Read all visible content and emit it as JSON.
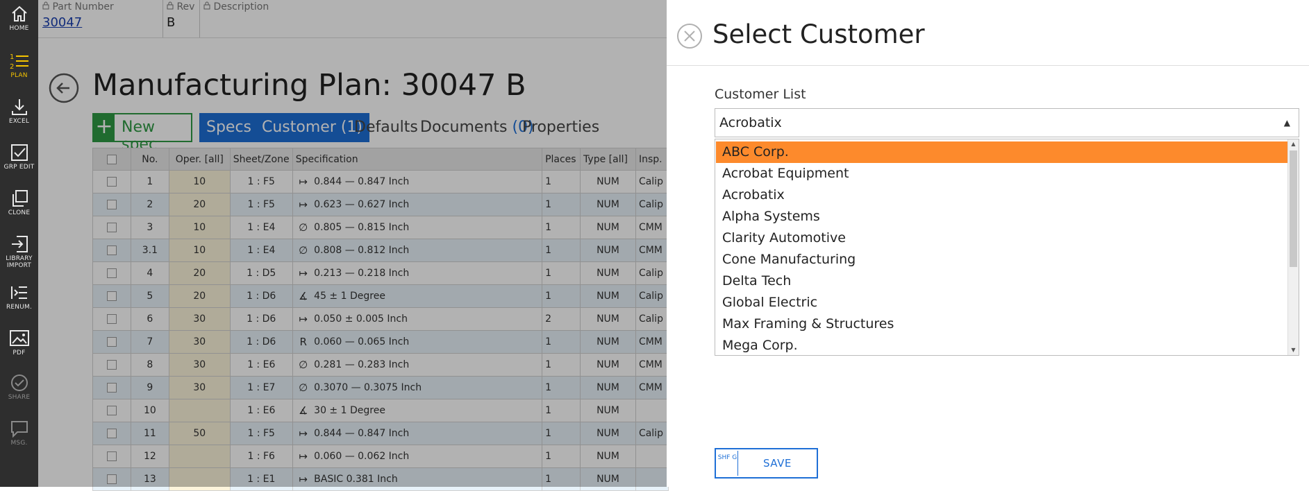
{
  "toolbar": {
    "items": [
      {
        "label": "HOME",
        "icon": "home-icon"
      },
      {
        "label": "PLAN",
        "icon": "plan-list-icon"
      },
      {
        "label": "EXCEL",
        "icon": "download-icon"
      },
      {
        "label": "GRP EDIT",
        "icon": "checkbox-edit-icon"
      },
      {
        "label": "CLONE",
        "icon": "clone-icon"
      },
      {
        "label": "LIBRARY IMPORT",
        "icon": "library-import-icon"
      },
      {
        "label": "RENUM.",
        "icon": "renumber-icon"
      },
      {
        "label": "PDF",
        "icon": "image-icon"
      },
      {
        "label": "SHARE",
        "icon": "check-circle-icon"
      },
      {
        "label": "MSG.",
        "icon": "message-icon"
      }
    ],
    "active_color": "#f5c400"
  },
  "header": {
    "part_number_label": "Part Number",
    "part_number_value": "30047",
    "rev_label": "Rev",
    "rev_value": "B",
    "description_label": "Description"
  },
  "main": {
    "title": "Manufacturing Plan: 30047 B",
    "new_spec_label": "New spec",
    "tabs": [
      {
        "label": "Specs"
      },
      {
        "label": "Customer (1)"
      },
      {
        "label": "Defaults"
      },
      {
        "label": "Documents",
        "count": "(0)"
      },
      {
        "label": "Properties"
      }
    ],
    "columns": [
      "No.",
      "Oper. [all]",
      "Sheet/Zone",
      "Specification",
      "Places",
      "Type [all]",
      "Insp."
    ],
    "rows": [
      {
        "no": "1",
        "oper": "10",
        "zone": "1 : F5",
        "sym": "↦",
        "spec": "0.844 — 0.847  Inch",
        "places": "1",
        "type": "NUM",
        "insp": "Calip"
      },
      {
        "no": "2",
        "oper": "20",
        "zone": "1 : F5",
        "sym": "↦",
        "spec": "0.623 — 0.627  Inch",
        "places": "1",
        "type": "NUM",
        "insp": "Calip"
      },
      {
        "no": "3",
        "oper": "10",
        "zone": "1 : E4",
        "sym": "∅",
        "spec": "0.805 — 0.815  Inch",
        "places": "1",
        "type": "NUM",
        "insp": "CMM"
      },
      {
        "no": "3.1",
        "oper": "10",
        "zone": "1 : E4",
        "sym": "∅",
        "spec": "0.808 — 0.812  Inch",
        "places": "1",
        "type": "NUM",
        "insp": "CMM"
      },
      {
        "no": "4",
        "oper": "20",
        "zone": "1 : D5",
        "sym": "↦",
        "spec": "0.213 — 0.218  Inch",
        "places": "1",
        "type": "NUM",
        "insp": "Calip"
      },
      {
        "no": "5",
        "oper": "20",
        "zone": "1 : D6",
        "sym": "∡",
        "spec": "45 ± 1  Degree",
        "places": "1",
        "type": "NUM",
        "insp": "Calip"
      },
      {
        "no": "6",
        "oper": "30",
        "zone": "1 : D6",
        "sym": "↦",
        "spec": "0.050 ± 0.005  Inch",
        "places": "2",
        "type": "NUM",
        "insp": "Calip"
      },
      {
        "no": "7",
        "oper": "30",
        "zone": "1 : D6",
        "sym": "R",
        "spec": "0.060 — 0.065  Inch",
        "places": "1",
        "type": "NUM",
        "insp": "CMM"
      },
      {
        "no": "8",
        "oper": "30",
        "zone": "1 : E6",
        "sym": "∅",
        "spec": "0.281 — 0.283  Inch",
        "places": "1",
        "type": "NUM",
        "insp": "CMM"
      },
      {
        "no": "9",
        "oper": "30",
        "zone": "1 : E7",
        "sym": "∅",
        "spec": "0.3070 — 0.3075  Inch",
        "places": "1",
        "type": "NUM",
        "insp": "CMM"
      },
      {
        "no": "10",
        "oper": "",
        "zone": "1 : E6",
        "sym": "∡",
        "spec": "30 ± 1  Degree",
        "places": "1",
        "type": "NUM",
        "insp": ""
      },
      {
        "no": "11",
        "oper": "50",
        "zone": "1 : F5",
        "sym": "↦",
        "spec": "0.844 — 0.847  Inch",
        "places": "1",
        "type": "NUM",
        "insp": "Calip"
      },
      {
        "no": "12",
        "oper": "",
        "zone": "1 : F6",
        "sym": "↦",
        "spec": "0.060 — 0.062  Inch",
        "places": "1",
        "type": "NUM",
        "insp": ""
      },
      {
        "no": "13",
        "oper": "",
        "zone": "1 : E1",
        "sym": "↦",
        "spec": "BASIC 0.381  Inch",
        "places": "1",
        "type": "NUM",
        "insp": ""
      }
    ]
  },
  "panel": {
    "title": "Select Customer",
    "field_label": "Customer List",
    "input_value": "Acrobatix",
    "options": [
      "ABC Corp.",
      "Acrobat Equipment",
      "Acrobatix",
      "Alpha Systems",
      "Clarity Automotive",
      "Cone Manufacturing",
      "Delta Tech",
      "Global Electric",
      "Max Framing & Structures",
      "Mega Corp."
    ],
    "selected_option": "ABC Corp.",
    "selected_color": "#fd8a2c",
    "save_key": "SHF G",
    "save_label": "SAVE"
  }
}
